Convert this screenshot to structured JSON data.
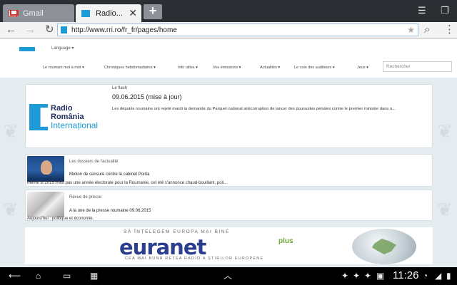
{
  "browser": {
    "tabs": [
      {
        "label": "Gmail",
        "icon": "gmail-icon",
        "active": false
      },
      {
        "label": "Radio...",
        "icon": "rri-favicon-icon",
        "active": true
      }
    ],
    "new_tab_label": "+",
    "address": {
      "url": "http://www.rri.ro/fr_fr/pages/home"
    }
  },
  "site": {
    "language_label": "Language",
    "menu": [
      "Le roumain mot à mot",
      "Chroniques hebdomadaires",
      "Info utiles",
      "Vos émissions",
      "Actualités",
      "Le coin des auditeurs",
      "Jeux"
    ],
    "search_placeholder": "Rechercher"
  },
  "flash": {
    "kicker": "Le flash",
    "date": "09.06.2015 (mise à jour)",
    "text": "Les députés roumains ont rejeté mardi la demande du Parquet national anticorruption de lancer des poursuites pénales contre le premier ministre dans u..."
  },
  "logo": {
    "line1": "Radio",
    "line2": "România",
    "line3": "Internațional"
  },
  "articles": [
    {
      "kicker": "Les dossiers de l'actualité",
      "title": "Motion de censure contre le cabinet Ponta",
      "desc": "Même si 2015 n'est pas une année électorale pour la Roumanie, cet été s'annonce chaud-bouillant, poli..."
    },
    {
      "kicker": "Revue de presse",
      "title": "A la une de la presse roumaine    09.06.2015",
      "desc": "Aujourd'hui : politique et économie."
    }
  ],
  "banner": {
    "slogan_top": "SĂ ÎNȚELEGEM EUROPA MAI BINE",
    "name": "euranet",
    "plus": "plus",
    "slogan_bottom": "CEA MAI BUNĂ REȚEA RADIO A ȘTIRILOR EUROPENE"
  },
  "status": {
    "time": "11:26"
  },
  "colors": {
    "accent": "#1d9bd6",
    "brand_dark": "#1e2f5f"
  }
}
